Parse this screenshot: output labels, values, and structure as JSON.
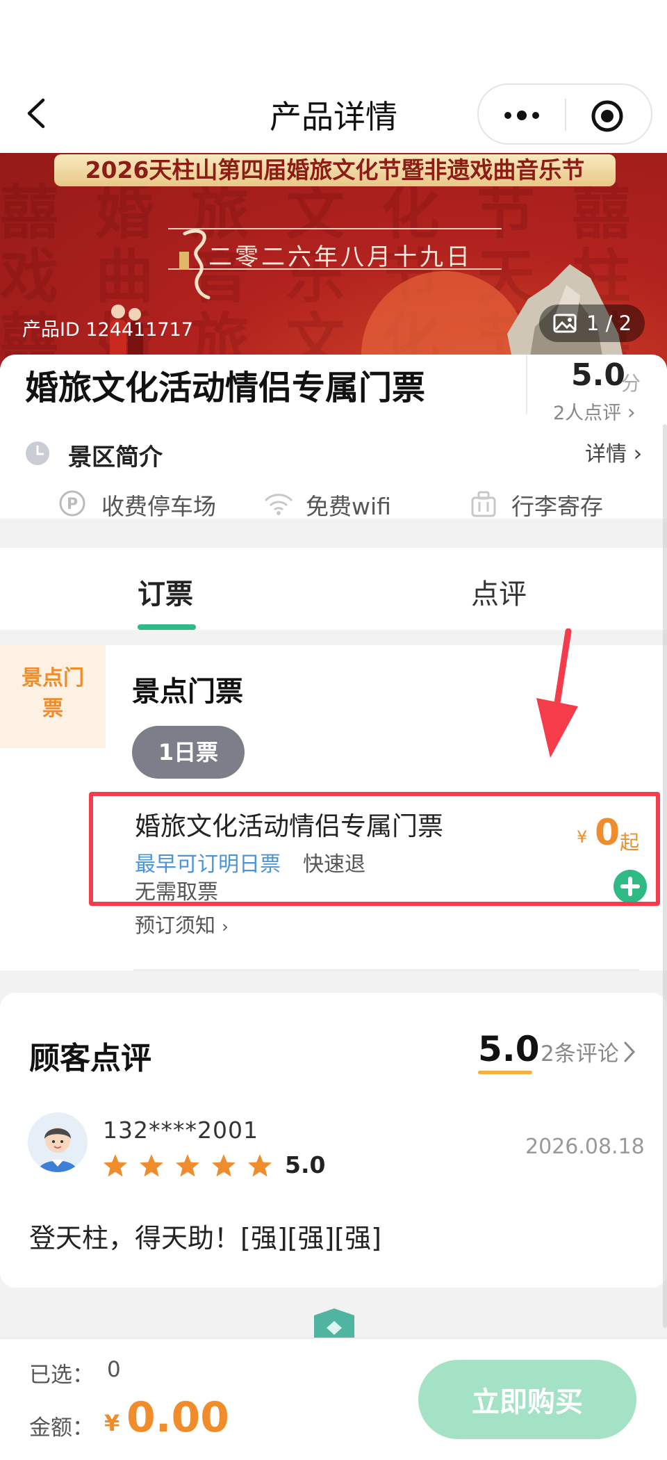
{
  "nav": {
    "title": "产品详情"
  },
  "banner": {
    "headline": "2026天柱山第四届婚旅文化节暨非遗戏曲音乐节",
    "date": "二零二六年八月十九日",
    "product_id": "产品ID 124411717",
    "photo_counter": "1 / 2"
  },
  "product": {
    "title": "婚旅文化活动情侣专属门票",
    "score": "5.0",
    "score_unit": "分",
    "review_count": "2人点评",
    "scenic_label": "景区简介",
    "details_link": "详情",
    "facilities": [
      {
        "label": "收费停车场",
        "icon": "parking-icon"
      },
      {
        "label": "免费wifi",
        "icon": "wifi-icon"
      },
      {
        "label": "行李寄存",
        "icon": "luggage-icon"
      }
    ]
  },
  "tabs": [
    {
      "label": "订票",
      "active": true
    },
    {
      "label": "点评",
      "active": false
    }
  ],
  "tickets": {
    "side_category": [
      "景点门",
      "票"
    ],
    "section_title": "景点门票",
    "day_pill": "1日票",
    "item": {
      "name": "婚旅文化活动情侣专属门票",
      "tag_booking": "最早可订明日票",
      "tag_refund": "快速退",
      "tag_noticket": "无需取票",
      "booking_notes": "预订须知",
      "price_symbol": "¥",
      "price": "0",
      "price_suffix": "起"
    }
  },
  "reviews": {
    "title": "顾客点评",
    "score": "5.0",
    "count": "2条评论",
    "items": [
      {
        "user": "132****2001",
        "rating": 5,
        "rating_text": "5.0",
        "date": "2026.08.18",
        "text": "登天柱，得天助！[强][强][强]"
      }
    ]
  },
  "bottom": {
    "selected_label": "已选：",
    "selected_count": "0",
    "amount_label": "金额：",
    "amount_symbol": "¥",
    "amount": "0.00",
    "buy_label": "立即购买"
  },
  "colors": {
    "accent_green": "#2fb985",
    "price_orange": "#ef8d2c",
    "link_blue": "#4a94dc",
    "highlight_red": "#f53c4b",
    "buy_button": "#a4e2c6"
  }
}
